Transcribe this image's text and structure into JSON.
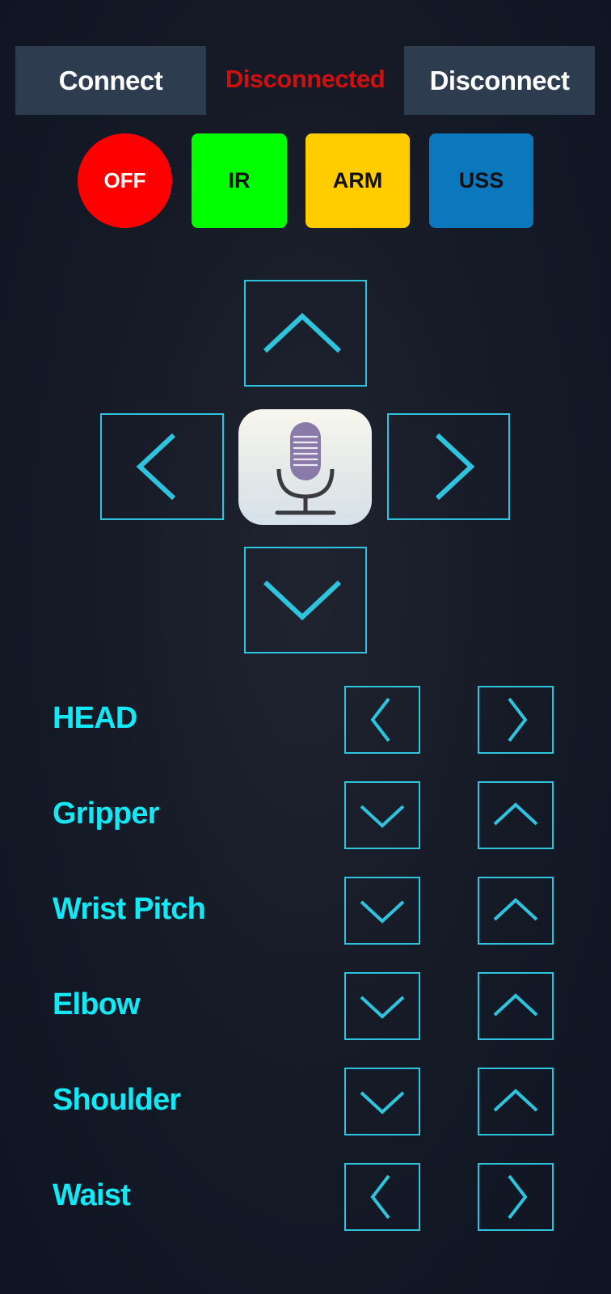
{
  "header": {
    "connect_label": "Connect",
    "status_text": "Disconnected",
    "disconnect_label": "Disconnect"
  },
  "modes": {
    "off_label": "OFF",
    "ir_label": "IR",
    "arm_label": "ARM",
    "uss_label": "USS"
  },
  "dpad": {
    "up_icon": "chevron-up-icon",
    "left_icon": "chevron-left-icon",
    "right_icon": "chevron-right-icon",
    "down_icon": "chevron-down-icon",
    "mic_icon": "microphone-icon"
  },
  "joints": [
    {
      "label": "HEAD",
      "controls": [
        "chevron-left-icon",
        "chevron-right-icon"
      ]
    },
    {
      "label": "Gripper",
      "controls": [
        "chevron-down-icon",
        "chevron-up-icon"
      ]
    },
    {
      "label": "Wrist Pitch",
      "controls": [
        "chevron-down-icon",
        "chevron-up-icon"
      ]
    },
    {
      "label": "Elbow",
      "controls": [
        "chevron-down-icon",
        "chevron-up-icon"
      ]
    },
    {
      "label": "Shoulder",
      "controls": [
        "chevron-down-icon",
        "chevron-up-icon"
      ]
    },
    {
      "label": "Waist",
      "controls": [
        "chevron-left-icon",
        "chevron-right-icon"
      ]
    }
  ],
  "colors": {
    "background": "#161b27",
    "top_button": "#2d3c4e",
    "status_red": "#d10f0f",
    "off": "#ff0000",
    "ir": "#00ff00",
    "arm": "#ffcc00",
    "uss": "#0b77bd",
    "accent_cyan": "#2fc4de",
    "label_cyan": "#15e8f5",
    "mic_purple": "#8a7aaa"
  }
}
